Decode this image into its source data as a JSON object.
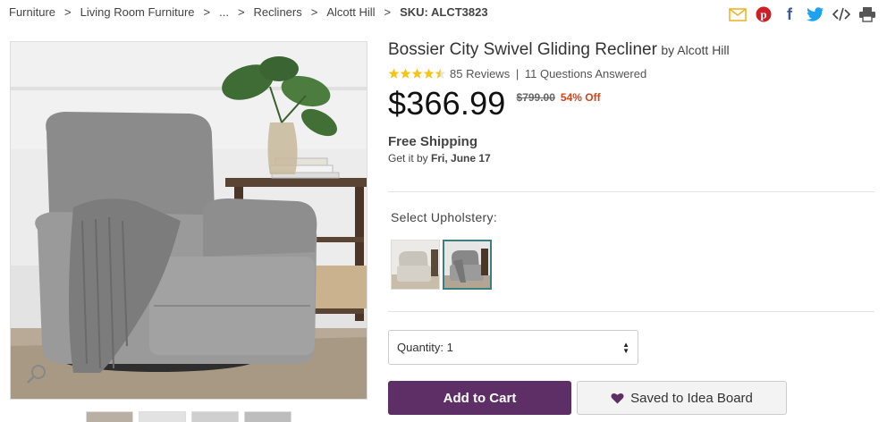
{
  "breadcrumb": {
    "items": [
      "Furniture",
      "Living Room Furniture",
      "...",
      "Recliners",
      "Alcott Hill"
    ],
    "separator": ">",
    "sku": "SKU: ALCT3823"
  },
  "share_icons": [
    "email-icon",
    "pinterest-icon",
    "facebook-icon",
    "twitter-icon",
    "embed-icon",
    "print-icon"
  ],
  "product": {
    "title": "Bossier City Swivel Gliding Recliner",
    "by": "by Alcott Hill",
    "rating": 4.5,
    "reviews": "85 Reviews",
    "rating_sep": "|",
    "questions": "11 Questions Answered",
    "price": "$366.99",
    "was_price": "$799.00",
    "discount": "54% Off"
  },
  "shipping": {
    "title": "Free Shipping",
    "date_prefix": "Get it by",
    "date": "Fri, June 17"
  },
  "upholstery": {
    "label": "Select Upholstery:",
    "selected_index": 1
  },
  "quantity": {
    "label": "Quantity: 1"
  },
  "actions": {
    "add_to_cart": "Add to Cart",
    "save_idea": "Saved to Idea Board"
  },
  "colors": {
    "accent": "#5d2f66",
    "discount": "#d0441b",
    "star": "#f5c518"
  }
}
